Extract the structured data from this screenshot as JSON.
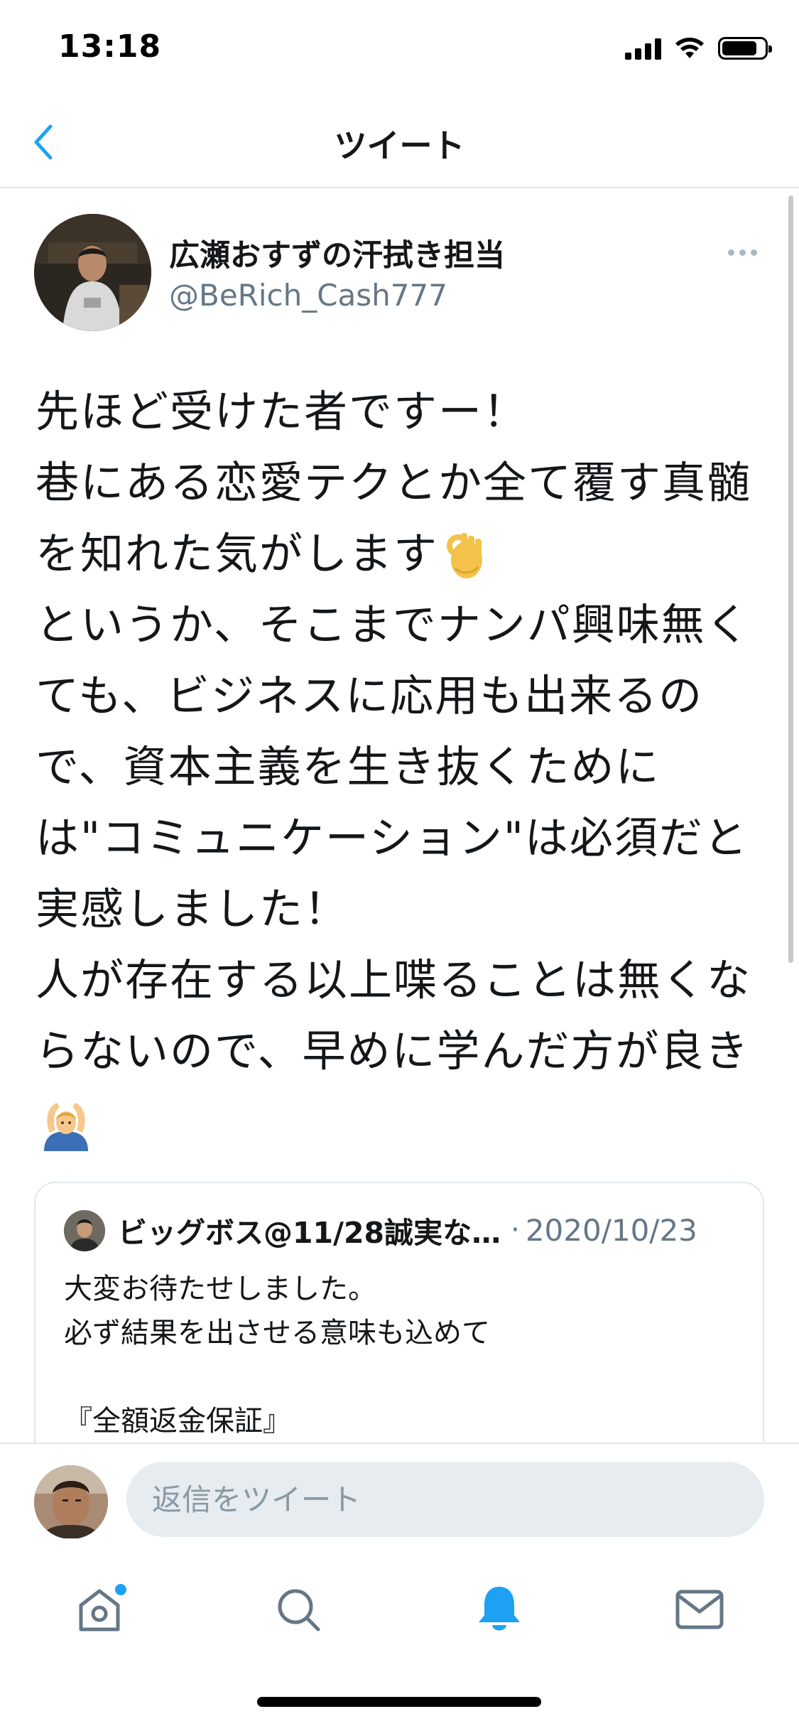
{
  "status_bar": {
    "time": "13:18"
  },
  "nav": {
    "title": "ツイート",
    "back_icon": "chevron-left-icon"
  },
  "tweet": {
    "author_name": "広瀬おすずの汗拭き担当",
    "author_handle": "@BeRich_Cash777",
    "text_part1": "先ほど受けた者ですー！\n巷にある恋愛テクとか全て覆す真髄を知れた気がします",
    "emoji_1": "ok-hand-emoji",
    "text_part2": "\nというか、そこまでナンパ興味無くても、ビジネスに応用も出来るので、資本主義を生き抜くためには\"コミュニケーション\"は必須だと実感しました！\n人が存在する以上喋ることは無くならないので、早めに学んだ方が良き",
    "emoji_2": "person-gesturing-ok-emoji"
  },
  "quoted_tweet": {
    "author_name": "ビッグボス@11/28誠実な…",
    "separator": "·",
    "date": "2020/10/23",
    "text": "大変お待たせしました。\n必ず結果を出させる意味も込めて\n\n『全額返金保証』"
  },
  "reply": {
    "placeholder": "返信をツイート"
  },
  "tab_bar": {
    "items": [
      {
        "name": "home",
        "icon": "home-icon",
        "has_badge": true
      },
      {
        "name": "search",
        "icon": "search-icon",
        "has_badge": false
      },
      {
        "name": "notifications",
        "icon": "bell-icon",
        "active": true
      },
      {
        "name": "messages",
        "icon": "mail-icon",
        "has_badge": false
      }
    ]
  },
  "colors": {
    "accent": "#1da1f2",
    "text_primary": "#14171a",
    "text_secondary": "#657786",
    "border": "#e1e8ed",
    "input_bg": "#e6ecf0"
  }
}
